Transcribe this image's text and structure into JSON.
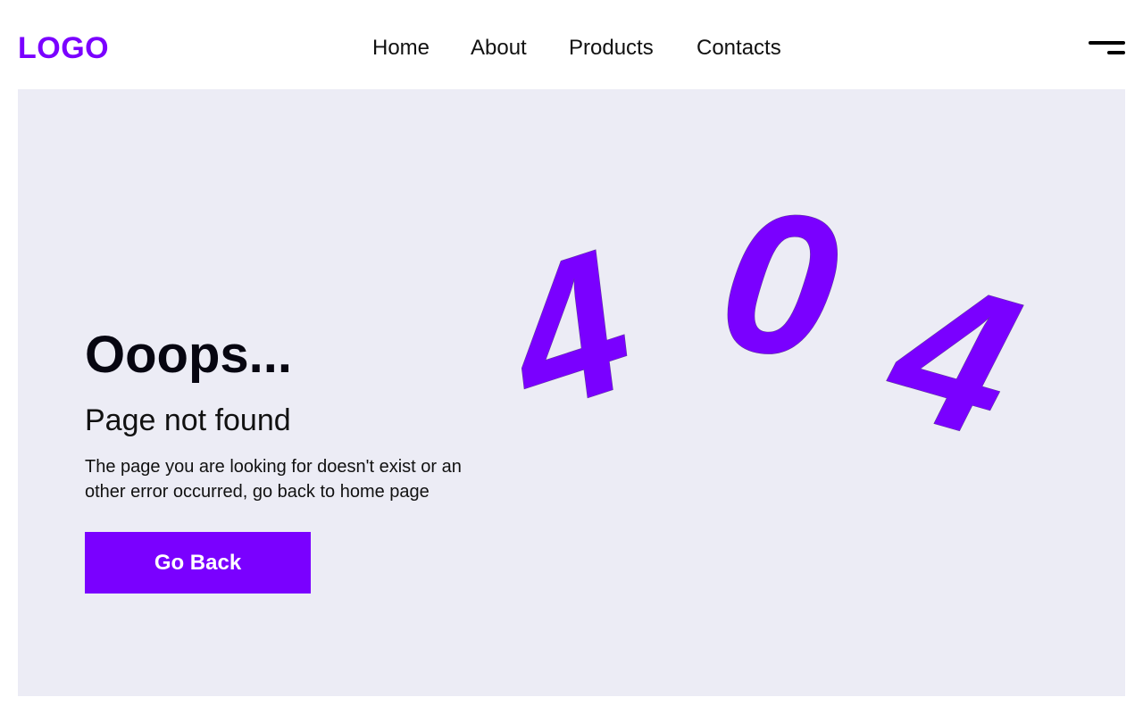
{
  "header": {
    "logo_text": "LOGO",
    "nav": {
      "home": "Home",
      "about": "About",
      "products": "Products",
      "contacts": "Contacts"
    },
    "menu_icon": "hamburger-menu-icon"
  },
  "main": {
    "heading": "Ooops...",
    "subheading": "Page not found",
    "description": "The page you are looking for doesn't exist or an other error occurred, go back to home page",
    "button_label": "Go Back",
    "error_digits": [
      "4",
      "0",
      "4"
    ]
  },
  "colors": {
    "accent": "#7a00ff",
    "panel_background": "#ececf5",
    "text": "#111111",
    "heading_text": "#070611",
    "button_text": "#ffffff"
  }
}
